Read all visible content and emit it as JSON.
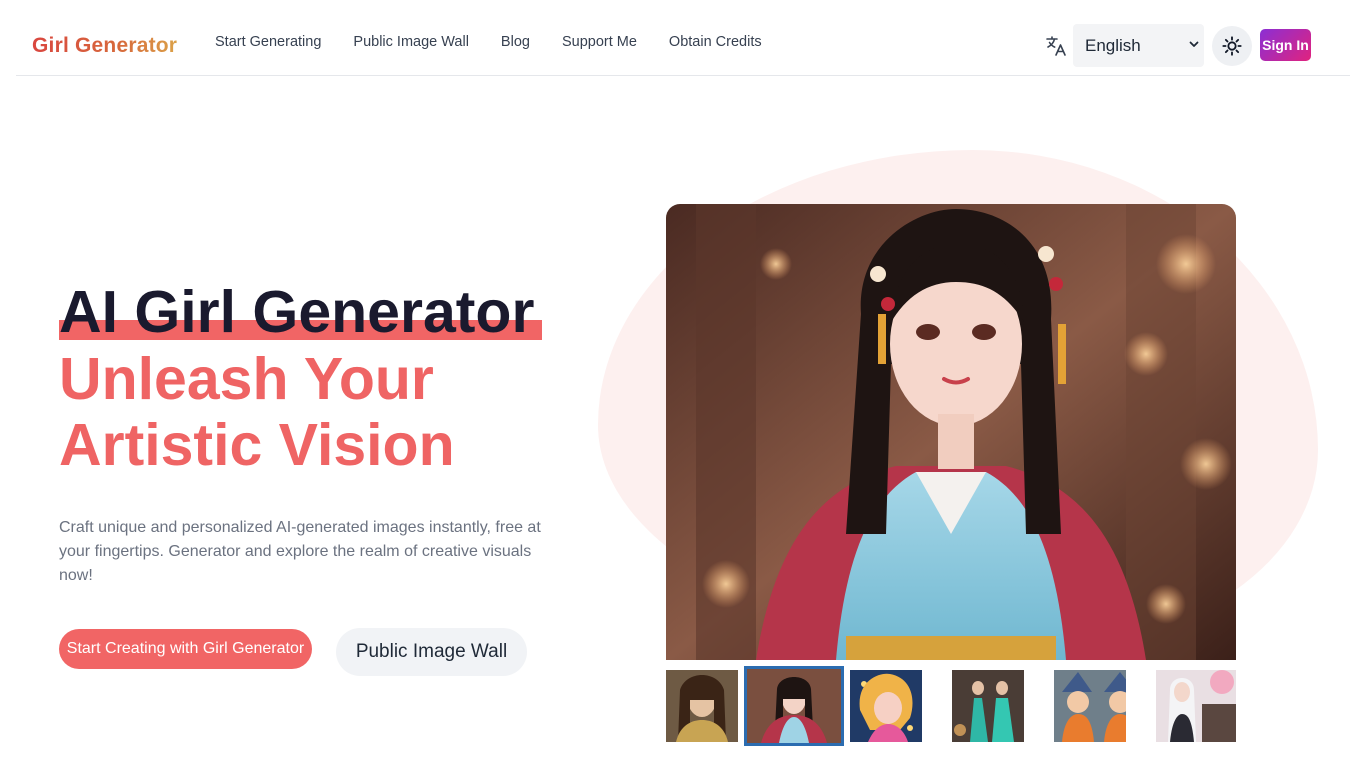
{
  "header": {
    "brand": "Girl Generator",
    "nav": [
      "Start Generating",
      "Public Image Wall",
      "Blog",
      "Support Me",
      "Obtain Credits"
    ],
    "language": {
      "selected": "English",
      "options": [
        "English"
      ]
    },
    "translate_icon": "translate-icon",
    "theme_icon": "sun-icon",
    "sign_in_label": "Sign In"
  },
  "hero": {
    "title": "AI Girl Generator",
    "subtitle": "Unleash Your Artistic Vision",
    "description": "Craft unique and personalized AI-generated images instantly, free at your fingertips. Generator and explore the realm of creative visuals now!",
    "primary_cta": "Start Creating with Girl Generator",
    "secondary_cta": "Public Image Wall"
  },
  "gallery": {
    "active_index": 1,
    "thumbnails": [
      "golden-haired woman portrait",
      "hanfu girl portrait",
      "anime girl with stars",
      "teal dress dancer",
      "twin witches",
      "white-haired girl with cherry blossoms"
    ]
  },
  "colors": {
    "accent": "#f16565",
    "title": "#1a1a2e",
    "signin_gradient_start": "#8b2fd4",
    "signin_gradient_end": "#e0237e",
    "active_thumb_border": "#2b6cb0"
  }
}
